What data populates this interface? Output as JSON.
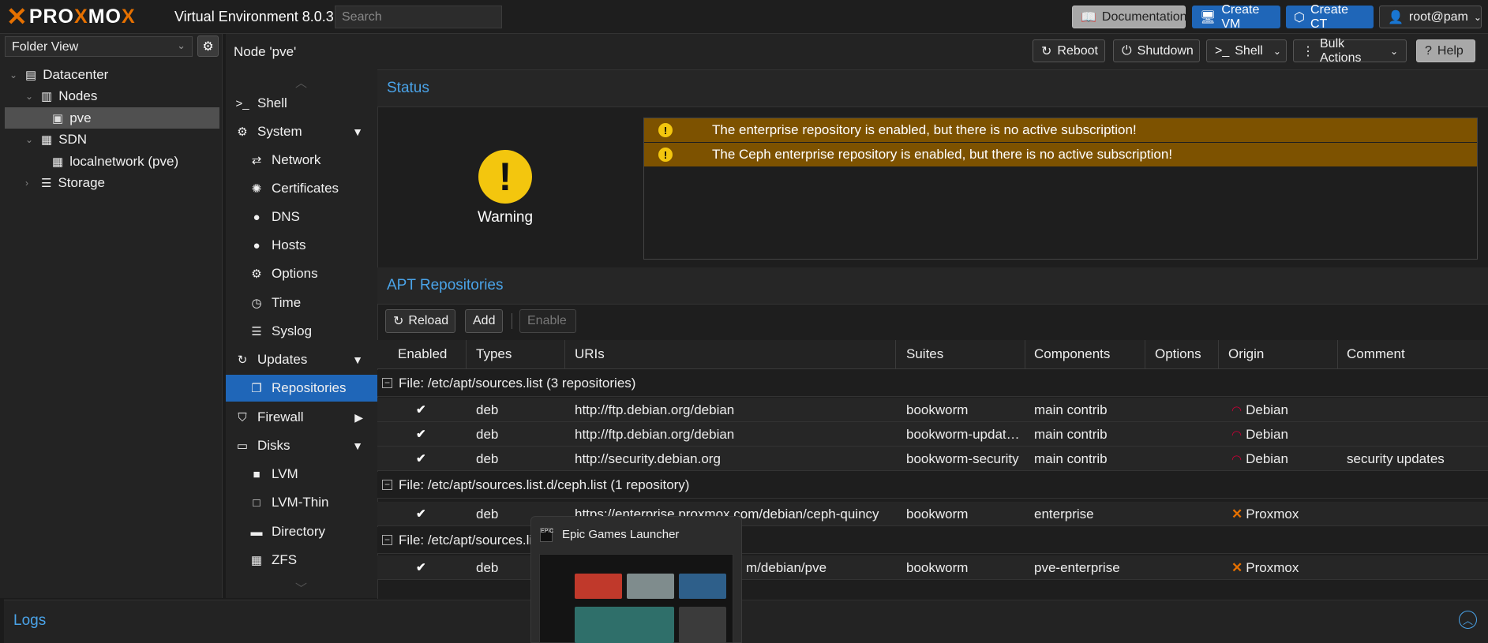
{
  "topbar": {
    "logo_x": "✕",
    "logo_text_pre": "PRO",
    "logo_text_x": "X",
    "logo_text_post": "MO",
    "logo_text_end": "X",
    "version": "Virtual Environment 8.0.3",
    "search_placeholder": "Search",
    "documentation": "Documentation",
    "create_vm": "Create VM",
    "create_ct": "Create CT",
    "user": "root@pam"
  },
  "left": {
    "folder_view": "Folder View",
    "tree": {
      "datacenter": "Datacenter",
      "nodes": "Nodes",
      "pve": "pve",
      "sdn": "SDN",
      "localnetwork": "localnetwork (pve)",
      "storage": "Storage"
    }
  },
  "node": {
    "title": "Node 'pve'",
    "reboot": "Reboot",
    "shutdown": "Shutdown",
    "shell": "Shell",
    "bulk_actions": "Bulk Actions",
    "help": "Help"
  },
  "nav": {
    "shell": "Shell",
    "system": "System",
    "network": "Network",
    "certificates": "Certificates",
    "dns": "DNS",
    "hosts": "Hosts",
    "options": "Options",
    "time": "Time",
    "syslog": "Syslog",
    "updates": "Updates",
    "repositories": "Repositories",
    "firewall": "Firewall",
    "disks": "Disks",
    "lvm": "LVM",
    "lvm_thin": "LVM-Thin",
    "directory": "Directory",
    "zfs": "ZFS"
  },
  "status": {
    "header": "Status",
    "label": "Warning",
    "messages": [
      "The enterprise repository is enabled, but there is no active subscription!",
      "The Ceph enterprise repository is enabled, but there is no active subscription!"
    ]
  },
  "apt": {
    "header": "APT Repositories",
    "reload": "Reload",
    "add": "Add",
    "enable": "Enable",
    "columns": [
      "Enabled",
      "Types",
      "URIs",
      "Suites",
      "Components",
      "Options",
      "Origin",
      "Comment"
    ],
    "groups": [
      "File: /etc/apt/sources.list (3 repositories)",
      "File: /etc/apt/sources.list.d/ceph.list (1 repository)",
      "File: /etc/apt/sources.lis"
    ],
    "rows": [
      {
        "enabled": "✔",
        "type": "deb",
        "uri": "http://ftp.debian.org/debian",
        "suite": "bookworm",
        "components": "main contrib",
        "origin": "Debian",
        "comment": ""
      },
      {
        "enabled": "✔",
        "type": "deb",
        "uri": "http://ftp.debian.org/debian",
        "suite": "bookworm-updat…",
        "components": "main contrib",
        "origin": "Debian",
        "comment": ""
      },
      {
        "enabled": "✔",
        "type": "deb",
        "uri": "http://security.debian.org",
        "suite": "bookworm-security",
        "components": "main contrib",
        "origin": "Debian",
        "comment": "security updates"
      },
      {
        "enabled": "✔",
        "type": "deb",
        "uri": "https://enterprise.proxmox.com/debian/ceph-quincy",
        "suite": "bookworm",
        "components": "enterprise",
        "origin": "Proxmox",
        "comment": ""
      },
      {
        "enabled": "✔",
        "type": "deb",
        "uri": "m/debian/pve",
        "suite": "bookworm",
        "components": "pve-enterprise",
        "origin": "Proxmox",
        "comment": ""
      }
    ]
  },
  "logs": {
    "title": "Logs"
  },
  "taskbar_popup": {
    "title": "Epic Games Launcher",
    "icon_text": "EPIC"
  },
  "colors": {
    "accent": "#4aa3e8",
    "selected": "#1f66b8",
    "warning_row": "#7d5200",
    "warning_icon": "#f3c60e",
    "brand_orange": "#e57000"
  }
}
